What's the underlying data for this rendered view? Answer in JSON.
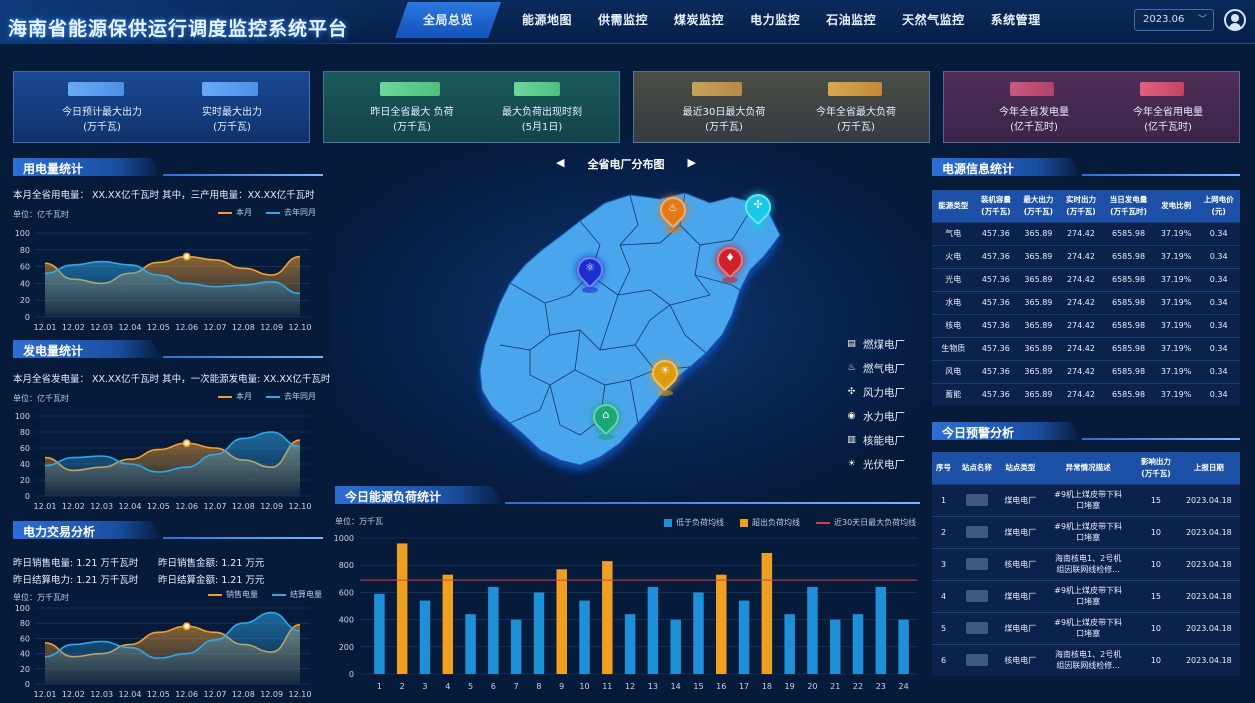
{
  "header": {
    "title": "海南省能源保供运行调度监控系统平台",
    "nav": [
      "全局总览",
      "能源地图",
      "供需监控",
      "煤炭监控",
      "电力监控",
      "石油监控",
      "天然气监控",
      "系统管理"
    ],
    "active_nav": "全局总览",
    "date": "2023.06"
  },
  "kpis": [
    {
      "labels": [
        "今日预计最大出力\n(万千瓦)",
        "实时最大出力\n(万千瓦)"
      ],
      "color": "#5a9cff"
    },
    {
      "labels": [
        "昨日全省最大 负荷\n(万千瓦)",
        "最大负荷出现时刻\n(5月1日)"
      ],
      "color": "#6fd18a"
    },
    {
      "labels": [
        "最近30日最大负荷\n(万千瓦)",
        "今年全省最大负荷\n(万千瓦)"
      ],
      "color": "#e0a64a"
    },
    {
      "labels": [
        "今年全省发电量\n(亿千瓦时)",
        "今年全省用电量\n(亿千瓦时)"
      ],
      "color": "#e05a7a"
    }
  ],
  "kpi_labels": {
    "k1a": "今日预计最大出力",
    "k1a_u": "(万千瓦)",
    "k1b": "实时最大出力",
    "k1b_u": "(万千瓦)",
    "k2a": "昨日全省最大 负荷",
    "k2a_u": "(万千瓦)",
    "k2b": "最大负荷出现时刻",
    "k2b_u": "(5月1日)",
    "k3a": "最近30日最大负荷",
    "k3a_u": "(万千瓦)",
    "k3b": "今年全省最大负荷",
    "k3b_u": "(万千瓦)",
    "k4a": "今年全省发电量",
    "k4a_u": "(亿千瓦时)",
    "k4b": "今年全省用电量",
    "k4b_u": "(亿千瓦时)"
  },
  "usage": {
    "title": "用电量统计",
    "stat": "本月全省用电量： XX.XX亿千瓦时    其中，三产用电量：XX.XX亿千瓦时",
    "unit": "单位：亿千瓦时",
    "legend": [
      "本月",
      "去年同月"
    ]
  },
  "generation": {
    "title": "发电量统计",
    "stat": "本月全省发电量：  XX.XX亿千瓦时    其中，一次能源发电量: XX.XX亿千瓦时",
    "unit": "单位：亿千瓦时",
    "legend": [
      "本月",
      "去年同月"
    ]
  },
  "trade": {
    "title": "电力交易分析",
    "stat1": "昨日销售电量: 1.21 万千瓦时",
    "stat2": "昨日销售金额: 1.21 万元",
    "stat3": "昨日结算电力: 1.21 万千瓦时",
    "stat4": "昨日结算金额: 1.21 万元",
    "unit": "单位：万千瓦时",
    "legend": [
      "销售电量",
      "结算电量"
    ]
  },
  "map": {
    "title": "全省电厂分布图",
    "legend": [
      "燃煤电厂",
      "燃气电厂",
      "风力电厂",
      "水力电厂",
      "核能电厂",
      "光伏电厂"
    ],
    "markers": [
      {
        "name": "燃煤电厂",
        "color": "#e07a1a"
      },
      {
        "name": "风力电厂",
        "color": "#18c8e8"
      },
      {
        "name": "核能电厂",
        "color": "#1a2fd0"
      },
      {
        "name": "燃气电厂",
        "color": "#d0202a"
      },
      {
        "name": "光伏电厂",
        "color": "#e09a10"
      },
      {
        "name": "水力电厂",
        "color": "#18a878"
      }
    ]
  },
  "power_info": {
    "title": "电源信息统计",
    "headers": [
      "能源类型",
      "装机容量\n(万千瓦)",
      "最大出力\n(万千瓦)",
      "实时出力\n(万千瓦)",
      "当日发电量\n(万千瓦时)",
      "发电比例",
      "上网电价\n(元)"
    ],
    "rows": [
      [
        "气电",
        "457.36",
        "365.89",
        "274.42",
        "6585.98",
        "37.19%",
        "0.34"
      ],
      [
        "火电",
        "457.36",
        "365.89",
        "274.42",
        "6585.98",
        "37.19%",
        "0.34"
      ],
      [
        "光电",
        "457.36",
        "365.89",
        "274.42",
        "6585.98",
        "37.19%",
        "0.34"
      ],
      [
        "水电",
        "457.36",
        "365.89",
        "274.42",
        "6585.98",
        "37.19%",
        "0.34"
      ],
      [
        "核电",
        "457.36",
        "365.89",
        "274.42",
        "6585.98",
        "37.19%",
        "0.34"
      ],
      [
        "生物质",
        "457.36",
        "365.89",
        "274.42",
        "6585.98",
        "37.19%",
        "0.34"
      ],
      [
        "风电",
        "457.36",
        "365.89",
        "274.42",
        "6585.98",
        "37.19%",
        "0.34"
      ],
      [
        "蓄能",
        "457.36",
        "365.89",
        "274.42",
        "6585.98",
        "37.19%",
        "0.34"
      ]
    ]
  },
  "warning": {
    "title": "今日预警分析",
    "headers": [
      "序号",
      "站点名称",
      "站点类型",
      "异常情况描述",
      "影响出力\n(万千瓦)",
      "上报日期"
    ],
    "rows": [
      [
        "1",
        "",
        "煤电电厂",
        "#9机上煤皮带下料\n口堵塞",
        "15",
        "2023.04.18"
      ],
      [
        "2",
        "",
        "煤电电厂",
        "#9机上煤皮带下料\n口堵塞",
        "10",
        "2023.04.18"
      ],
      [
        "3",
        "",
        "核电电厂",
        "海南核电1、2号机\n组因联网线检修...",
        "10",
        "2023.04.18"
      ],
      [
        "4",
        "",
        "煤电电厂",
        "#9机上煤皮带下料\n口堵塞",
        "15",
        "2023.04.18"
      ],
      [
        "5",
        "",
        "煤电电厂",
        "#9机上煤皮带下料\n口堵塞",
        "10",
        "2023.04.18"
      ],
      [
        "6",
        "",
        "核电电厂",
        "海南核电1、2号机\n组因联网线检修...",
        "10",
        "2023.04.18"
      ]
    ]
  },
  "load": {
    "title": "今日能源负荷统计",
    "unit": "单位：万千瓦",
    "legend": [
      "低于负荷均线",
      "超出负荷均线",
      "近30天日最大负荷均线"
    ]
  },
  "chart_data": [
    {
      "type": "area",
      "title": "用电量统计",
      "x": [
        "12.01",
        "12.02",
        "12.03",
        "12.04",
        "12.05",
        "12.06",
        "12.07",
        "12.08",
        "12.09",
        "12.10"
      ],
      "ylim": [
        0,
        100
      ],
      "yticks": [
        0,
        20,
        40,
        60,
        80,
        100
      ],
      "series": [
        {
          "name": "本月",
          "color": "#f0a030",
          "values": [
            64,
            45,
            40,
            52,
            65,
            72,
            68,
            58,
            50,
            72
          ]
        },
        {
          "name": "去年同月",
          "color": "#30a8e8",
          "values": [
            52,
            62,
            66,
            62,
            50,
            40,
            36,
            38,
            42,
            28
          ]
        }
      ]
    },
    {
      "type": "area",
      "title": "发电量统计",
      "x": [
        "12.01",
        "12.02",
        "12.03",
        "12.04",
        "12.05",
        "12.06",
        "12.07",
        "12.08",
        "12.09",
        "12.10"
      ],
      "ylim": [
        0,
        100
      ],
      "yticks": [
        0,
        20,
        40,
        60,
        80,
        100
      ],
      "series": [
        {
          "name": "本月",
          "color": "#f0a030",
          "values": [
            48,
            32,
            36,
            46,
            58,
            66,
            60,
            45,
            36,
            70
          ]
        },
        {
          "name": "去年同月",
          "color": "#30a8e8",
          "values": [
            38,
            48,
            50,
            40,
            30,
            36,
            52,
            72,
            80,
            62
          ]
        }
      ]
    },
    {
      "type": "area",
      "title": "电力交易分析",
      "x": [
        "12.01",
        "12.02",
        "12.03",
        "12.04",
        "12.05",
        "12.06",
        "12.07",
        "12.08",
        "12.09",
        "12.10"
      ],
      "ylim": [
        0,
        100
      ],
      "yticks": [
        0,
        20,
        40,
        60,
        80,
        100
      ],
      "series": [
        {
          "name": "销售电量",
          "color": "#f0a030",
          "values": [
            54,
            36,
            40,
            52,
            68,
            76,
            68,
            52,
            42,
            78
          ]
        },
        {
          "name": "结算电量",
          "color": "#30a8e8",
          "values": [
            36,
            52,
            56,
            48,
            34,
            40,
            58,
            80,
            94,
            70
          ]
        }
      ]
    },
    {
      "type": "bar",
      "title": "今日能源负荷统计",
      "ylabel": "万千瓦",
      "categories": [
        "1",
        "2",
        "3",
        "4",
        "5",
        "6",
        "7",
        "8",
        "9",
        "10",
        "11",
        "12",
        "13",
        "14",
        "15",
        "16",
        "17",
        "18",
        "19",
        "20",
        "21",
        "22",
        "23",
        "24"
      ],
      "values": [
        590,
        960,
        540,
        730,
        440,
        640,
        400,
        600,
        770,
        540,
        830,
        440,
        640,
        400,
        600,
        730,
        540,
        890,
        440,
        640,
        400,
        440,
        640,
        400
      ],
      "ylim": [
        0,
        1000
      ],
      "yticks": [
        0,
        200,
        400,
        600,
        800,
        1000
      ],
      "avg_line": 690,
      "colors": {
        "below": "#1e90d8",
        "above": "#f0a020",
        "avg": "#d04050"
      }
    }
  ]
}
